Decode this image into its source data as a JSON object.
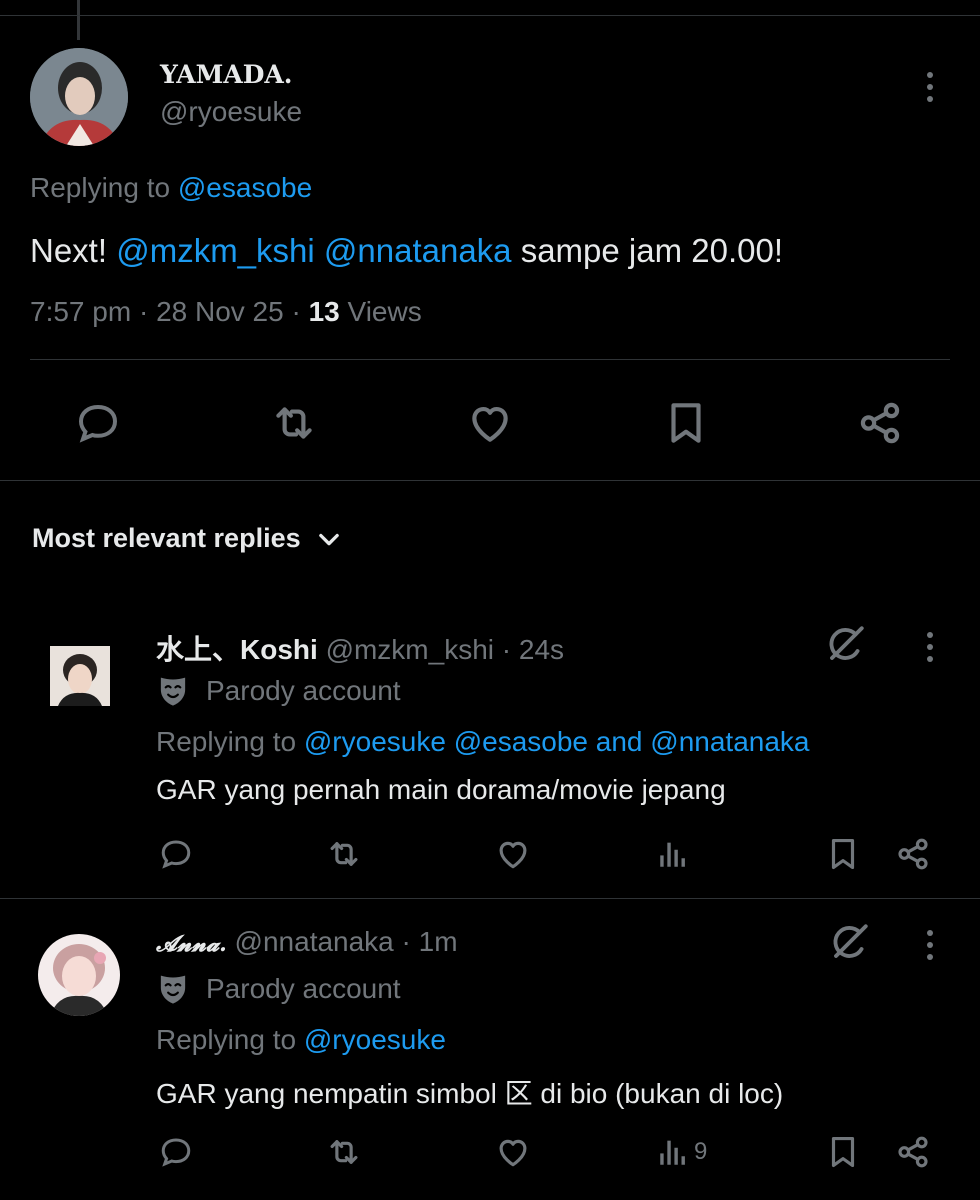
{
  "main_tweet": {
    "display_name": "YAMADA.",
    "handle": "@ryoesuke",
    "replying_prefix": "Replying to",
    "replying_to": "@esasobe",
    "text_lead": "Next!",
    "mention_1": "@mzkm_kshi",
    "mention_2": "@nnatanaka",
    "text_tail": "sampe jam 20.00!",
    "time": "7:57 pm",
    "date": "28 Nov 25",
    "views_count": "13",
    "views_label": "Views",
    "separator": "·"
  },
  "replies_header": {
    "label": "Most relevant replies"
  },
  "replies": [
    {
      "display_name": "水上、Koshi",
      "handle": "@mzkm_kshi",
      "time": "24s",
      "badge": "Parody account",
      "replying_prefix": "Replying to",
      "replying_1": "@ryoesuke",
      "replying_2": "@esasobe",
      "replying_and": "and",
      "replying_3": "@nnatanaka",
      "text": "GAR yang pernah main dorama/movie jepang",
      "views": ""
    },
    {
      "display_name": "𝓐𝓷𝓷𝓪.",
      "handle": "@nnatanaka",
      "time": "1m",
      "badge": "Parody account",
      "replying_prefix": "Replying to",
      "replying_1": "@ryoesuke",
      "text": "GAR yang nempatin simbol 区 di bio (bukan di loc)",
      "views": "9"
    }
  ],
  "colors": {
    "background": "#000000",
    "text": "#e7e9ea",
    "secondary": "#71767b",
    "link": "#1d9bf0",
    "divider": "#2f3336"
  }
}
